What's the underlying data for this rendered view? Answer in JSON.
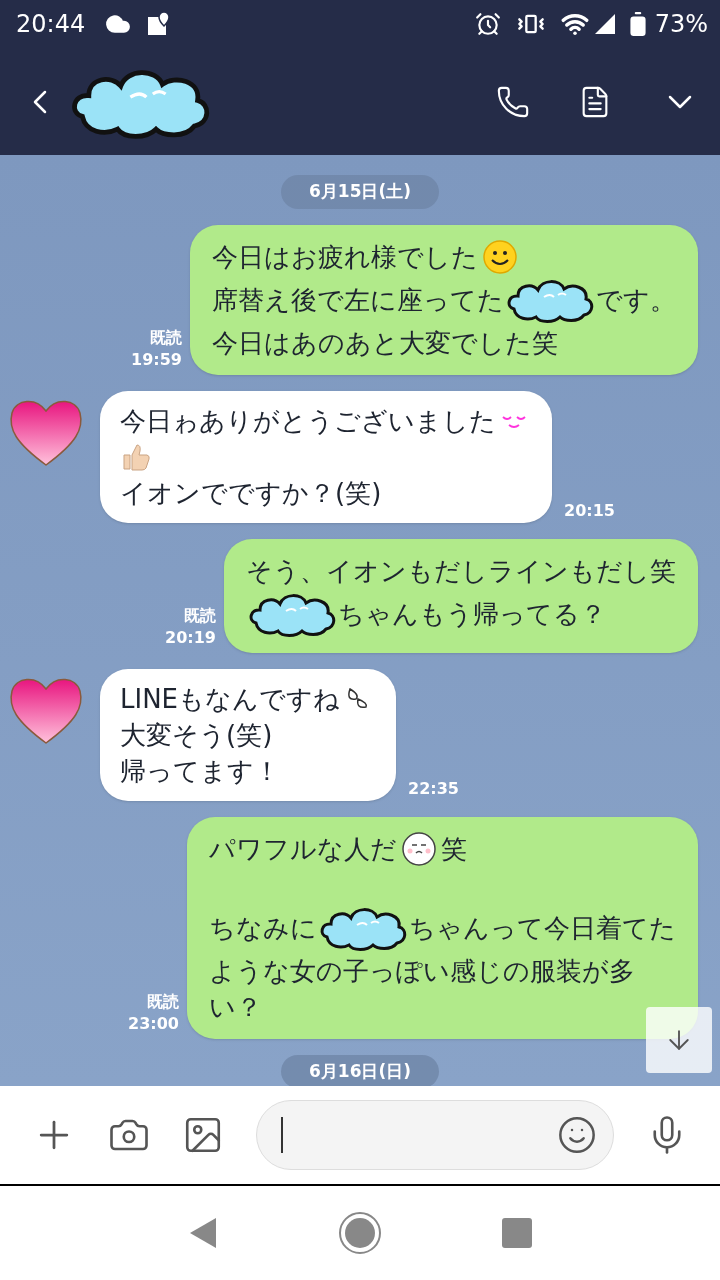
{
  "status_bar": {
    "time": "20:44",
    "battery": "73%"
  },
  "chat": [
    {
      "kind": "date",
      "text": "6月15日(土)"
    },
    {
      "kind": "outgoing",
      "read": "既読",
      "time": "19:59",
      "lines": [
        {
          "kind": "text",
          "parts": [
            {
              "kind": "text",
              "text": "今日はお疲れ様でした"
            },
            {
              "kind": "smiley"
            }
          ]
        },
        {
          "kind": "text",
          "parts": [
            {
              "kind": "text",
              "text": "席替え後で左に座ってた"
            },
            {
              "kind": "cloud"
            },
            {
              "kind": "text",
              "text": "です。"
            }
          ]
        },
        {
          "kind": "text",
          "parts": [
            {
              "kind": "text",
              "text": "今日はあのあと大変でした笑"
            }
          ]
        }
      ]
    },
    {
      "kind": "incoming",
      "time": "20:15",
      "lines": [
        {
          "kind": "text",
          "parts": [
            {
              "kind": "text",
              "text": "今日ゎありがとうございました"
            },
            {
              "kind": "blush"
            }
          ]
        },
        {
          "kind": "text",
          "parts": [
            {
              "kind": "thumbs_up"
            }
          ]
        },
        {
          "kind": "text",
          "parts": [
            {
              "kind": "text",
              "text": "イオンでですか？(笑)"
            }
          ]
        }
      ]
    },
    {
      "kind": "outgoing",
      "read": "既読",
      "time": "20:19",
      "lines": [
        {
          "kind": "text",
          "parts": [
            {
              "kind": "text",
              "text": "そう、イオンもだしラインもだし笑"
            }
          ]
        },
        {
          "kind": "text",
          "parts": [
            {
              "kind": "cloud"
            },
            {
              "kind": "text",
              "text": "ちゃんもう帰ってる？"
            }
          ]
        }
      ]
    },
    {
      "kind": "incoming",
      "time": "22:35",
      "lines": [
        {
          "kind": "text",
          "parts": [
            {
              "kind": "text",
              "text": "LINEもなんですね"
            },
            {
              "kind": "sweat"
            }
          ]
        },
        {
          "kind": "text",
          "parts": [
            {
              "kind": "text",
              "text": "大変そう(笑)"
            }
          ]
        },
        {
          "kind": "text",
          "parts": [
            {
              "kind": "text",
              "text": "帰ってます！"
            }
          ]
        }
      ]
    },
    {
      "kind": "outgoing",
      "read": "既読",
      "time": "23:00",
      "lines": [
        {
          "kind": "text",
          "parts": [
            {
              "kind": "text",
              "text": "パワフルな人だ"
            },
            {
              "kind": "face"
            },
            {
              "kind": "text",
              "text": "笑"
            }
          ]
        },
        {
          "kind": "blank"
        },
        {
          "kind": "text",
          "parts": [
            {
              "kind": "text",
              "text": "ちなみに"
            },
            {
              "kind": "cloud"
            },
            {
              "kind": "text",
              "text": "ちゃんって今日着てた"
            }
          ]
        },
        {
          "kind": "text",
          "parts": [
            {
              "kind": "text",
              "text": "ような女の子っぽい感じの服装が多"
            }
          ]
        },
        {
          "kind": "text",
          "parts": [
            {
              "kind": "text",
              "text": "い？"
            }
          ]
        }
      ]
    },
    {
      "kind": "date",
      "text": "6月16日(日)"
    }
  ]
}
